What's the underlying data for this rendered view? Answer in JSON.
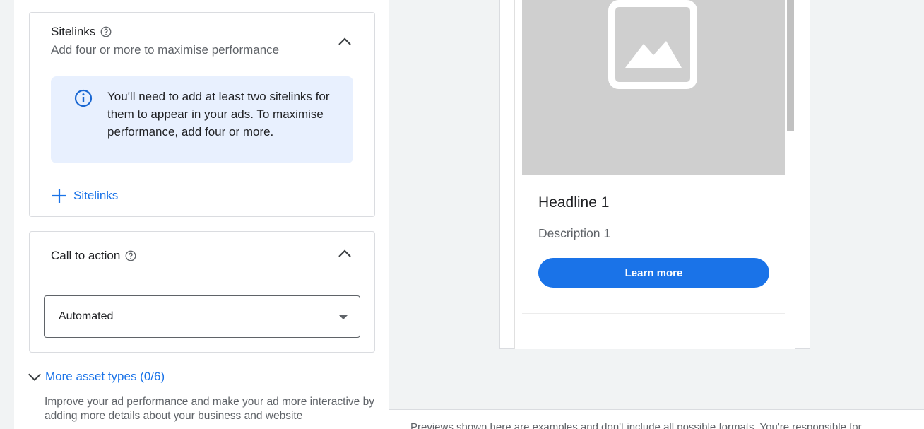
{
  "sitelinks": {
    "title": "Sitelinks",
    "subtitle": "Add four or more to maximise performance",
    "info_text": "You'll need to add at least two sitelinks for them to appear in your ads. To maximise performance, add four or more.",
    "add_label": "Sitelinks"
  },
  "call_to_action": {
    "title": "Call to action",
    "selected_value": "Automated"
  },
  "more_assets": {
    "label": "More asset types (0/6)",
    "description": "Improve your ad performance and make your ad more interactive by adding more details about your business and website"
  },
  "preview": {
    "headline": "Headline 1",
    "description": "Description 1",
    "button_label": "Learn more",
    "footer_text": "Previews shown here are examples and don't include all possible formats. You're responsible for"
  },
  "colors": {
    "accent": "#1a73e8",
    "info_bg": "#e8f0fe",
    "placeholder_bg": "#cfcfcf"
  }
}
